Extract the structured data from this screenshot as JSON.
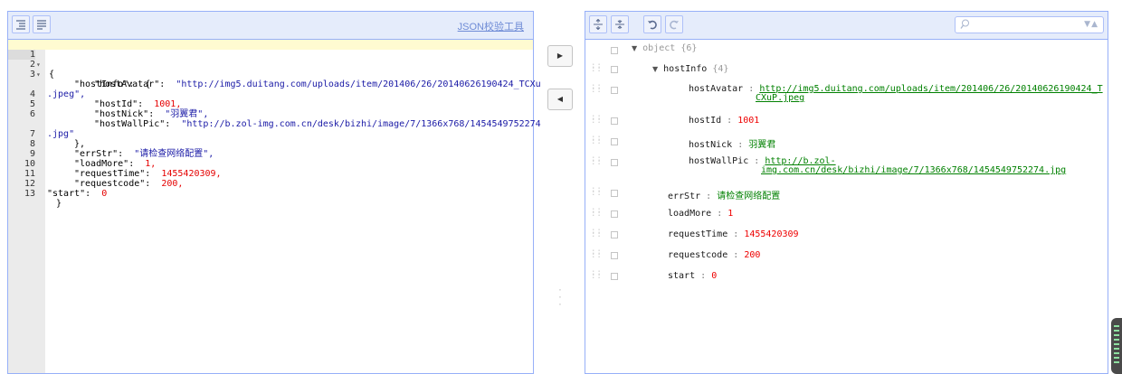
{
  "left_panel": {
    "format_btn": "format",
    "compact_btn": "compact",
    "link_label": "JSON校验工具",
    "lines": [
      {
        "n": "1",
        "fold": "▾"
      },
      {
        "n": "2",
        "fold": "▾",
        "t1": "\"hostInfo\":"
      },
      {
        "n": "3",
        "t1": "\"hostAvatar\":",
        "t2": "\"http://img5.duitang.com/uploads/item/201406/26/20140626190424_TCXu"
      },
      {
        "n": "",
        "t2": ".jpeg\","
      },
      {
        "n": "4",
        "t1": "\"hostId\":",
        "t2": "1001,"
      },
      {
        "n": "5",
        "t1": "\"hostNick\":",
        "t2": "\"羽翼君\","
      },
      {
        "n": "6",
        "t1": "\"hostWallPic\":",
        "t2": "\"http://b.zol-img.com.cn/desk/bizhi/image/7/1366x768/1454549752274"
      },
      {
        "n": "",
        "t2": ".jpg\""
      },
      {
        "n": "7",
        "t1": "},"
      },
      {
        "n": "8",
        "t1": "\"errStr\":",
        "t2": "\"请检查网络配置\","
      },
      {
        "n": "9",
        "t1": "\"loadMore\":",
        "t2": "1,"
      },
      {
        "n": "10",
        "t1": "\"requestTime\":",
        "t2": "1455420309,"
      },
      {
        "n": "11",
        "t1": "\"requestcode\":",
        "t2": "200,"
      },
      {
        "n": "12",
        "t1": "\"start\":",
        "t2": "0"
      },
      {
        "n": "13",
        "t1": "}"
      }
    ]
  },
  "middle": {
    "to_right": "▶",
    "to_left": "◀",
    "splitter": "⋮"
  },
  "right_panel": {
    "search_placeholder": "",
    "tree": {
      "root_label": "object",
      "root_count": "{6}",
      "hostInfo_key": "hostInfo",
      "hostInfo_count": "{4}",
      "hostAvatar_key": "hostAvatar",
      "hostAvatar_val1": "http://img5.duitang.com/uploads/item/201406/26/20140626190424_T",
      "hostAvatar_val2": "CXuP.jpeg",
      "hostId_key": "hostId",
      "hostId_val": "1001",
      "hostNick_key": "hostNick",
      "hostNick_val": "羽翼君",
      "hostWallPic_key": "hostWallPic",
      "hostWallPic_val1": "http://b.zol-",
      "hostWallPic_val2": "img.com.cn/desk/bizhi/image/7/1366x768/1454549752274.jpg",
      "errStr_key": "errStr",
      "errStr_val": "请检查网络配置",
      "loadMore_key": "loadMore",
      "loadMore_val": "1",
      "requestTime_key": "requestTime",
      "requestTime_val": "1455420309",
      "requestcode_key": "requestcode",
      "requestcode_val": "200",
      "start_key": "start",
      "start_val": "0",
      "colon": ":"
    }
  }
}
